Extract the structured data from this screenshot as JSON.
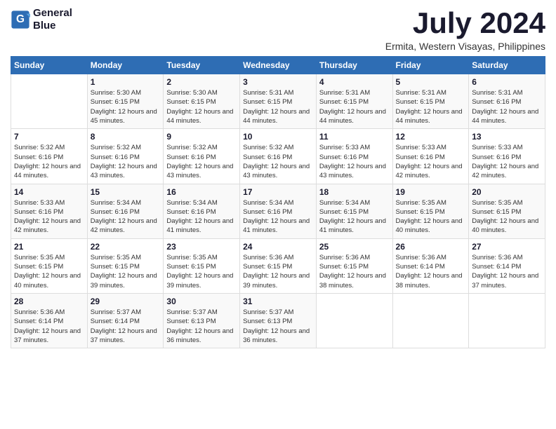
{
  "logo": {
    "line1": "General",
    "line2": "Blue"
  },
  "title": "July 2024",
  "location": "Ermita, Western Visayas, Philippines",
  "days_of_week": [
    "Sunday",
    "Monday",
    "Tuesday",
    "Wednesday",
    "Thursday",
    "Friday",
    "Saturday"
  ],
  "weeks": [
    [
      {
        "day": "",
        "info": ""
      },
      {
        "day": "1",
        "info": "Sunrise: 5:30 AM\nSunset: 6:15 PM\nDaylight: 12 hours\nand 45 minutes."
      },
      {
        "day": "2",
        "info": "Sunrise: 5:30 AM\nSunset: 6:15 PM\nDaylight: 12 hours\nand 44 minutes."
      },
      {
        "day": "3",
        "info": "Sunrise: 5:31 AM\nSunset: 6:15 PM\nDaylight: 12 hours\nand 44 minutes."
      },
      {
        "day": "4",
        "info": "Sunrise: 5:31 AM\nSunset: 6:15 PM\nDaylight: 12 hours\nand 44 minutes."
      },
      {
        "day": "5",
        "info": "Sunrise: 5:31 AM\nSunset: 6:15 PM\nDaylight: 12 hours\nand 44 minutes."
      },
      {
        "day": "6",
        "info": "Sunrise: 5:31 AM\nSunset: 6:16 PM\nDaylight: 12 hours\nand 44 minutes."
      }
    ],
    [
      {
        "day": "7",
        "info": "Sunrise: 5:32 AM\nSunset: 6:16 PM\nDaylight: 12 hours\nand 44 minutes."
      },
      {
        "day": "8",
        "info": "Sunrise: 5:32 AM\nSunset: 6:16 PM\nDaylight: 12 hours\nand 43 minutes."
      },
      {
        "day": "9",
        "info": "Sunrise: 5:32 AM\nSunset: 6:16 PM\nDaylight: 12 hours\nand 43 minutes."
      },
      {
        "day": "10",
        "info": "Sunrise: 5:32 AM\nSunset: 6:16 PM\nDaylight: 12 hours\nand 43 minutes."
      },
      {
        "day": "11",
        "info": "Sunrise: 5:33 AM\nSunset: 6:16 PM\nDaylight: 12 hours\nand 43 minutes."
      },
      {
        "day": "12",
        "info": "Sunrise: 5:33 AM\nSunset: 6:16 PM\nDaylight: 12 hours\nand 42 minutes."
      },
      {
        "day": "13",
        "info": "Sunrise: 5:33 AM\nSunset: 6:16 PM\nDaylight: 12 hours\nand 42 minutes."
      }
    ],
    [
      {
        "day": "14",
        "info": "Sunrise: 5:33 AM\nSunset: 6:16 PM\nDaylight: 12 hours\nand 42 minutes."
      },
      {
        "day": "15",
        "info": "Sunrise: 5:34 AM\nSunset: 6:16 PM\nDaylight: 12 hours\nand 42 minutes."
      },
      {
        "day": "16",
        "info": "Sunrise: 5:34 AM\nSunset: 6:16 PM\nDaylight: 12 hours\nand 41 minutes."
      },
      {
        "day": "17",
        "info": "Sunrise: 5:34 AM\nSunset: 6:16 PM\nDaylight: 12 hours\nand 41 minutes."
      },
      {
        "day": "18",
        "info": "Sunrise: 5:34 AM\nSunset: 6:15 PM\nDaylight: 12 hours\nand 41 minutes."
      },
      {
        "day": "19",
        "info": "Sunrise: 5:35 AM\nSunset: 6:15 PM\nDaylight: 12 hours\nand 40 minutes."
      },
      {
        "day": "20",
        "info": "Sunrise: 5:35 AM\nSunset: 6:15 PM\nDaylight: 12 hours\nand 40 minutes."
      }
    ],
    [
      {
        "day": "21",
        "info": "Sunrise: 5:35 AM\nSunset: 6:15 PM\nDaylight: 12 hours\nand 40 minutes."
      },
      {
        "day": "22",
        "info": "Sunrise: 5:35 AM\nSunset: 6:15 PM\nDaylight: 12 hours\nand 39 minutes."
      },
      {
        "day": "23",
        "info": "Sunrise: 5:35 AM\nSunset: 6:15 PM\nDaylight: 12 hours\nand 39 minutes."
      },
      {
        "day": "24",
        "info": "Sunrise: 5:36 AM\nSunset: 6:15 PM\nDaylight: 12 hours\nand 39 minutes."
      },
      {
        "day": "25",
        "info": "Sunrise: 5:36 AM\nSunset: 6:15 PM\nDaylight: 12 hours\nand 38 minutes."
      },
      {
        "day": "26",
        "info": "Sunrise: 5:36 AM\nSunset: 6:14 PM\nDaylight: 12 hours\nand 38 minutes."
      },
      {
        "day": "27",
        "info": "Sunrise: 5:36 AM\nSunset: 6:14 PM\nDaylight: 12 hours\nand 37 minutes."
      }
    ],
    [
      {
        "day": "28",
        "info": "Sunrise: 5:36 AM\nSunset: 6:14 PM\nDaylight: 12 hours\nand 37 minutes."
      },
      {
        "day": "29",
        "info": "Sunrise: 5:37 AM\nSunset: 6:14 PM\nDaylight: 12 hours\nand 37 minutes."
      },
      {
        "day": "30",
        "info": "Sunrise: 5:37 AM\nSunset: 6:13 PM\nDaylight: 12 hours\nand 36 minutes."
      },
      {
        "day": "31",
        "info": "Sunrise: 5:37 AM\nSunset: 6:13 PM\nDaylight: 12 hours\nand 36 minutes."
      },
      {
        "day": "",
        "info": ""
      },
      {
        "day": "",
        "info": ""
      },
      {
        "day": "",
        "info": ""
      }
    ]
  ]
}
